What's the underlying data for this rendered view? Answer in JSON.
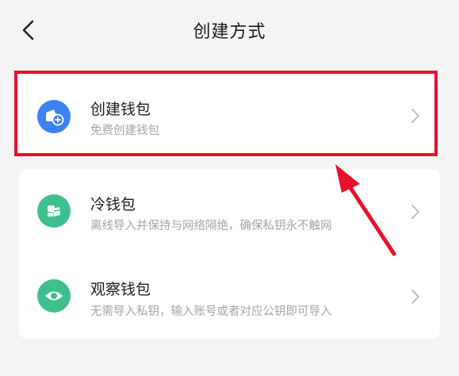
{
  "header": {
    "title": "创建方式"
  },
  "options": [
    {
      "title": "创建钱包",
      "subtitle": "免费创建钱包",
      "icon": "wallet-plus-icon",
      "color": "#3b82f0"
    },
    {
      "title": "冷钱包",
      "subtitle": "离线导入并保持与网络隔绝，确保私钥永不触网",
      "icon": "cold-wallet-icon",
      "color": "#3ec08e"
    },
    {
      "title": "观察钱包",
      "subtitle": "无需导入私钥，输入账号或者对应公钥即可导入",
      "icon": "eye-icon",
      "color": "#3ec08e"
    }
  ],
  "annotation": {
    "highlight_color": "#e8102a"
  }
}
